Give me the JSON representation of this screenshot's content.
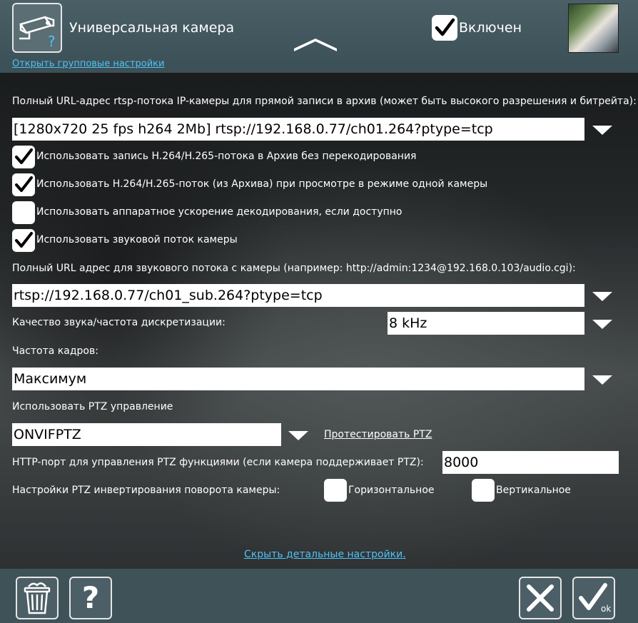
{
  "header": {
    "title": "Универсальная камера",
    "group_settings_link": "Открыть групповые настройки",
    "enabled_label": "Включен",
    "enabled_checked": true
  },
  "main_stream": {
    "label": "Полный URL-адрес rtsp-потока IP-камеры для прямой записи в архив (может быть высокого разрешения и битрейта):",
    "value": "[1280x720 25 fps h264 2Mb] rtsp://192.168.0.77/ch01.264?ptype=tcp"
  },
  "options": [
    {
      "label": "Использовать запись H.264/H.265-потока в Архив без перекодирования",
      "checked": true
    },
    {
      "label": "Использовать H.264/H.265-поток (из Архива) при просмотре в режиме одной камеры",
      "checked": true
    },
    {
      "label": "Использовать аппаратное ускорение декодирования, если доступно",
      "checked": false
    },
    {
      "label": "Использовать звуковой поток камеры",
      "checked": true
    }
  ],
  "audio": {
    "url_label": "Полный URL адрес для звукового потока с камеры (например: http://admin:1234@192.168.0.103/audio.cgi):",
    "url_value": "rtsp://192.168.0.77/ch01_sub.264?ptype=tcp",
    "quality_label": "Качество звука/частота дискретизации:",
    "quality_value": "8 kHz"
  },
  "framerate": {
    "label": "Частота кадров:",
    "value": "Максимум"
  },
  "ptz": {
    "label": "Использовать PTZ управление",
    "value": "ONVIFPTZ",
    "test_link": "Протестировать PTZ",
    "port_label": "HTTP-порт для управления PTZ функциями (если камера поддерживает PTZ):",
    "port_value": "8000",
    "invert_label": "Настройки PTZ инвертирования поворота камеры:",
    "horizontal_label": "Горизонтальное",
    "horizontal_checked": false,
    "vertical_label": "Вертикальное",
    "vertical_checked": false
  },
  "hide_details_link": "Скрыть детальные настройки.",
  "footer": {
    "ok_label": "ok"
  },
  "colors": {
    "header_bg": "#4a5f66",
    "link": "#4fc3f7",
    "field_bg": "#ffffff"
  },
  "icons": [
    "camera-icon",
    "help-question-icon",
    "chevron-up-icon",
    "checkmark-icon",
    "dropdown-arrow-icon",
    "trash-icon",
    "question-icon",
    "close-x-icon",
    "ok-check-icon"
  ]
}
